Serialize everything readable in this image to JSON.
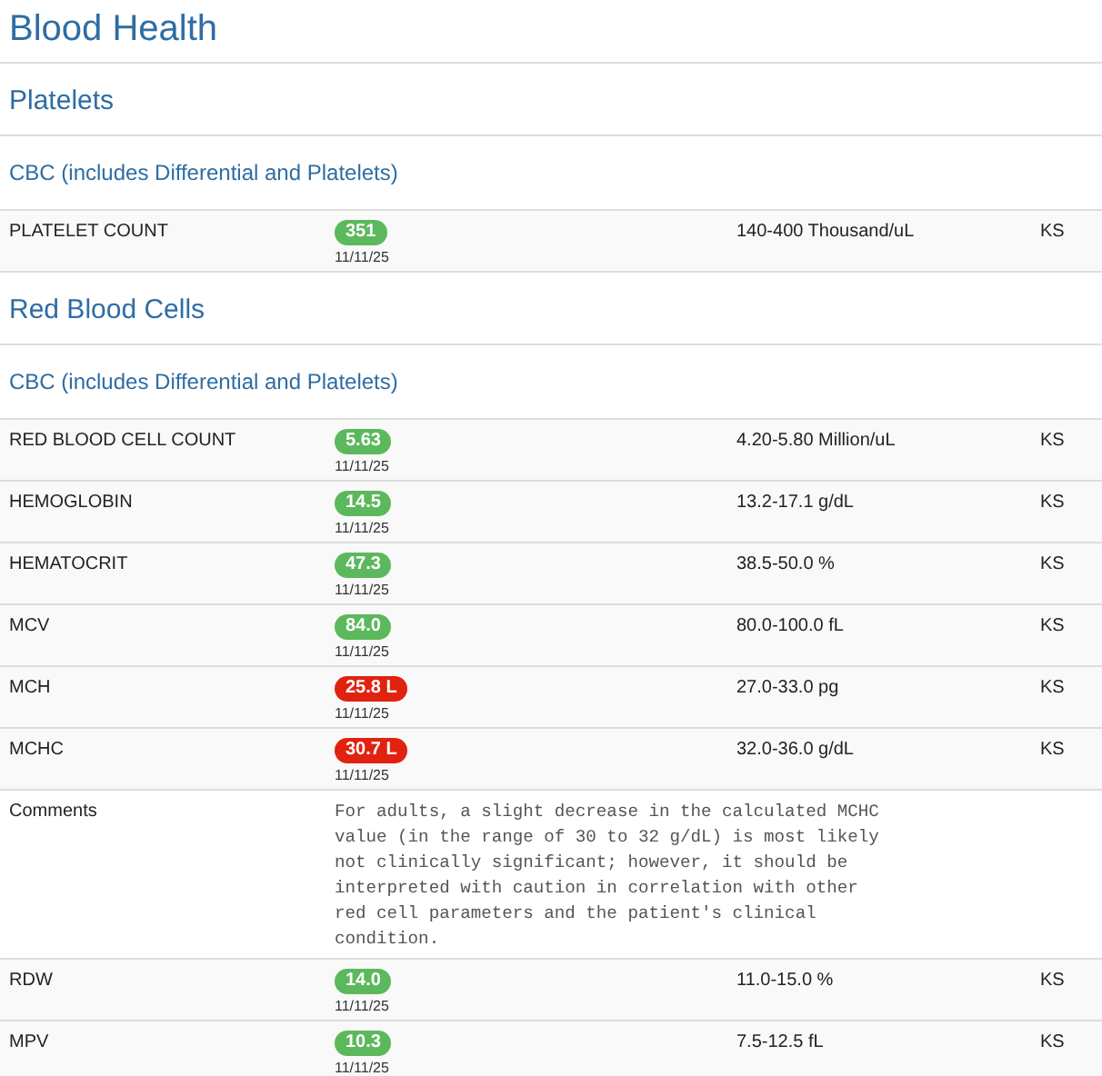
{
  "title": "Blood Health",
  "sections": [
    {
      "heading": "Platelets",
      "panel": "CBC (includes Differential and Platelets)",
      "rows": [
        {
          "kind": "result",
          "name": "PLATELET COUNT",
          "value": "351",
          "abnormal": false,
          "date": "11/11/25",
          "range": "140-400 Thousand/uL",
          "lab": "KS"
        }
      ]
    },
    {
      "heading": "Red Blood Cells",
      "panel": "CBC (includes Differential and Platelets)",
      "rows": [
        {
          "kind": "result",
          "name": "RED BLOOD CELL COUNT",
          "value": "5.63",
          "abnormal": false,
          "date": "11/11/25",
          "range": "4.20-5.80 Million/uL",
          "lab": "KS"
        },
        {
          "kind": "result",
          "name": "HEMOGLOBIN",
          "value": "14.5",
          "abnormal": false,
          "date": "11/11/25",
          "range": "13.2-17.1 g/dL",
          "lab": "KS"
        },
        {
          "kind": "result",
          "name": "HEMATOCRIT",
          "value": "47.3",
          "abnormal": false,
          "date": "11/11/25",
          "range": "38.5-50.0 %",
          "lab": "KS"
        },
        {
          "kind": "result",
          "name": "MCV",
          "value": "84.0",
          "abnormal": false,
          "date": "11/11/25",
          "range": "80.0-100.0 fL",
          "lab": "KS"
        },
        {
          "kind": "result",
          "name": "MCH",
          "value": "25.8 L",
          "abnormal": true,
          "date": "11/11/25",
          "range": "27.0-33.0 pg",
          "lab": "KS"
        },
        {
          "kind": "result",
          "name": "MCHC",
          "value": "30.7 L",
          "abnormal": true,
          "date": "11/11/25",
          "range": "32.0-36.0 g/dL",
          "lab": "KS"
        },
        {
          "kind": "comment",
          "name": "Comments",
          "text": "For adults, a slight decrease in the calculated MCHC value (in the range of 30 to 32 g/dL) is most likely not clinically significant; however, it should be interpreted with caution in correlation with other red cell parameters and the patient's clinical condition."
        },
        {
          "kind": "result",
          "name": "RDW",
          "value": "14.0",
          "abnormal": false,
          "date": "11/11/25",
          "range": "11.0-15.0 %",
          "lab": "KS"
        },
        {
          "kind": "result",
          "name": "MPV",
          "value": "10.3",
          "abnormal": false,
          "date": "11/11/25",
          "range": "7.5-12.5 fL",
          "lab": "KS"
        }
      ]
    }
  ]
}
